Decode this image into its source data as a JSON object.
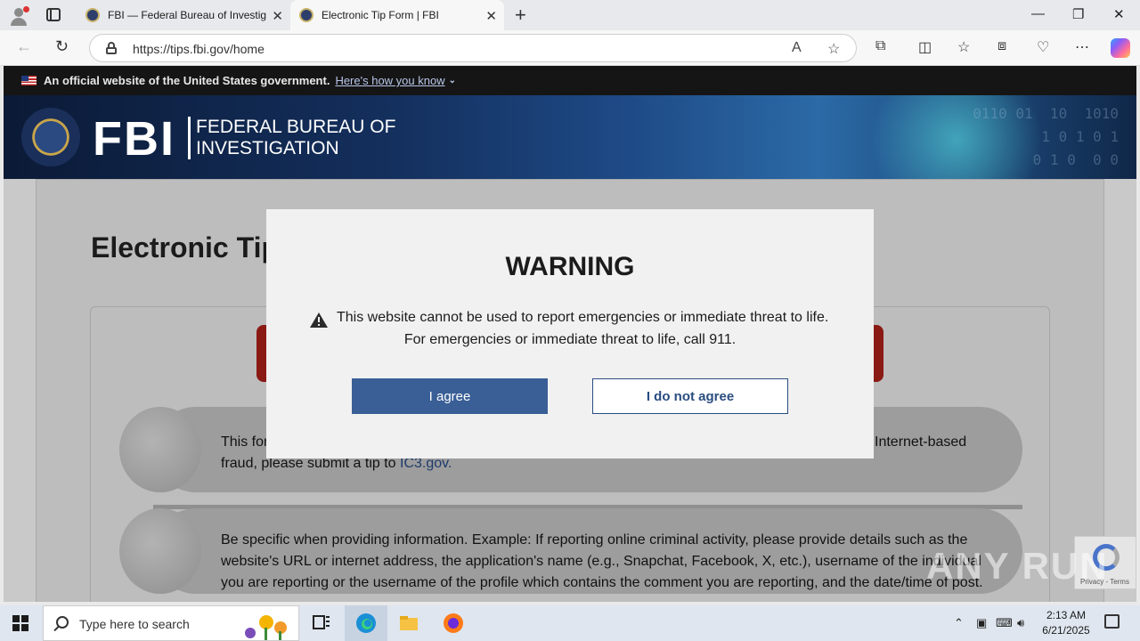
{
  "browser": {
    "tabs": [
      {
        "title": "FBI — Federal Bureau of Investigation",
        "active": false
      },
      {
        "title": "Electronic Tip Form | FBI",
        "active": true
      }
    ],
    "url": "https://tips.fbi.gov/home"
  },
  "gov_banner": {
    "text": "An official website of the United States government.",
    "link": "Here's how you know"
  },
  "header": {
    "logo_text": "FBI",
    "subtitle_line1": "FEDERAL BUREAU OF",
    "subtitle_line2": "INVESTIGATION"
  },
  "page": {
    "title": "Electronic Tip",
    "item1_text_a": "This for",
    "item1_text_b": "Internet-based",
    "item1_text_c": "fraud, please submit a tip to",
    "item1_link": "IC3.gov.",
    "item2_line1": "Be specific when providing information. Example: If reporting online criminal activity, please provide details such as the",
    "item2_line2": "website's URL or internet address, the application's name (e.g., Snapchat, Facebook, X, etc.), username of the individual",
    "item2_line3": "you are reporting or the username of the profile which contains the comment you are reporting, and the date/time of post."
  },
  "modal": {
    "title": "WARNING",
    "line1": "This website cannot be used to report emergencies or immediate threat to life.",
    "line2": "For emergencies or immediate threat to life, call 911.",
    "agree_label": "I agree",
    "disagree_label": "I do not agree"
  },
  "recaptcha": {
    "text": "Privacy - Terms"
  },
  "watermark": "ANY RUN",
  "taskbar": {
    "search_placeholder": "Type here to search",
    "time": "2:13 AM",
    "date": "6/21/2025"
  },
  "colors": {
    "agree_button": "#3a5f96",
    "warning_red": "#8a1a14"
  }
}
